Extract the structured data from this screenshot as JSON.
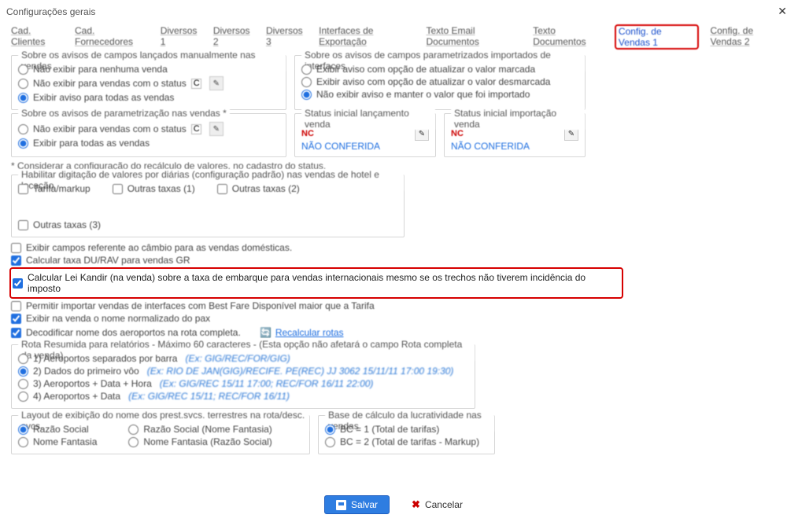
{
  "window": {
    "title": "Configurações gerais"
  },
  "tabs": {
    "cad_clientes": "Cad. Clientes",
    "cad_fornecedores": "Cad. Fornecedores",
    "diversos1": "Diversos 1",
    "diversos2": "Diversos 2",
    "diversos3": "Diversos 3",
    "interfaces": "Interfaces de Exportação",
    "texto_email": "Texto Email Documentos",
    "texto_doc": "Texto Documentos",
    "config_vendas1": "Config. de Vendas 1",
    "config_vendas2": "Config. de Vendas 2"
  },
  "group1": {
    "legend": "Sobre os avisos de campos lançados manualmente nas vendas",
    "r1": "Não exibir para nenhuma venda",
    "r2": "Não exibir para vendas com o status",
    "r2_val": "CF",
    "r3": "Exibir aviso para todas as vendas"
  },
  "group2": {
    "legend": "Sobre os avisos de campos parametrizados importados de interfaces",
    "r1": "Exibir aviso com opção de atualizar o valor marcada",
    "r2": "Exibir aviso com opção de atualizar o valor desmarcada",
    "r3": "Não exibir aviso e manter o valor que foi importado"
  },
  "group3": {
    "legend": "Sobre os avisos de parametrização nas vendas *",
    "r1": "Não exibir para vendas com o status",
    "r1_val": "CF",
    "r2": "Exibir para todas as vendas"
  },
  "group4": {
    "legend": "Status inicial lançamento venda",
    "code": "NC",
    "link": "NÃO CONFERIDA"
  },
  "group5": {
    "legend": "Status inicial importação venda",
    "code": "NC",
    "link": "NÃO CONFERIDA"
  },
  "note1": "* Considerar a configuração do recálculo de valores, no cadastro do status.",
  "group6": {
    "legend": "Habilitar digitação de valores por diárias (configuração padrão) nas vendas de hotel e locação",
    "c1": "Tarifa/markup",
    "c2": "Outras taxas (1)",
    "c3": "Outras taxas (2)",
    "c4": "Outras taxas (3)"
  },
  "checks": {
    "cambio": "Exibir campos referente ao câmbio para as vendas domésticas.",
    "durav": "Calcular taxa DU/RAV para vendas GR",
    "kandir": "Calcular Lei Kandir (na venda) sobre a taxa de embarque para vendas internacionais mesmo se os trechos não tiverem incidência do imposto",
    "bestfare": "Permitir importar vendas de interfaces com Best Fare Disponível maior que a Tarifa",
    "nomenorm": "Exibir na venda o nome normalizado do pax",
    "decod": "Decodificar nome dos aeroportos na rota completa.",
    "recalc": "Recalcular rotas"
  },
  "group7": {
    "legend": "Rota Resumida para relatórios - Máximo 60 caracteres - (Esta opção não afetará o campo Rota completa da venda)",
    "r1": "1) Aeroportos separados por barra",
    "r1_ex": "(Ex: GIG/REC/FOR/GIG)",
    "r2": "2) Dados do primeiro vôo",
    "r2_ex": "(Ex: RIO DE JAN(GIG)/RECIFE. PE(REC) JJ 3062 15/11/11 17:00 19:30)",
    "r3": "3) Aeroportos + Data + Hora",
    "r3_ex": "(Ex: GIG/REC 15/11 17:00; REC/FOR 16/11 22:00)",
    "r4": "4) Aeroportos + Data",
    "r4_ex": "(Ex: GIG/REC 15/11; REC/FOR 16/11)"
  },
  "group8": {
    "legend": "Layout de exibição do nome dos prest.svcs. terrestres na rota/desc. svcs.",
    "r1": "Razão Social",
    "r2": "Nome Fantasia",
    "r3": "Razão Social (Nome Fantasia)",
    "r4": "Nome Fantasia (Razão Social)"
  },
  "group9": {
    "legend": "Base de cálculo da lucratividade nas vendas",
    "r1": "BC = 1 (Total de tarifas)",
    "r2": "BC = 2 (Total de tarifas - Markup)"
  },
  "buttons": {
    "save": "Salvar",
    "cancel": "Cancelar"
  }
}
